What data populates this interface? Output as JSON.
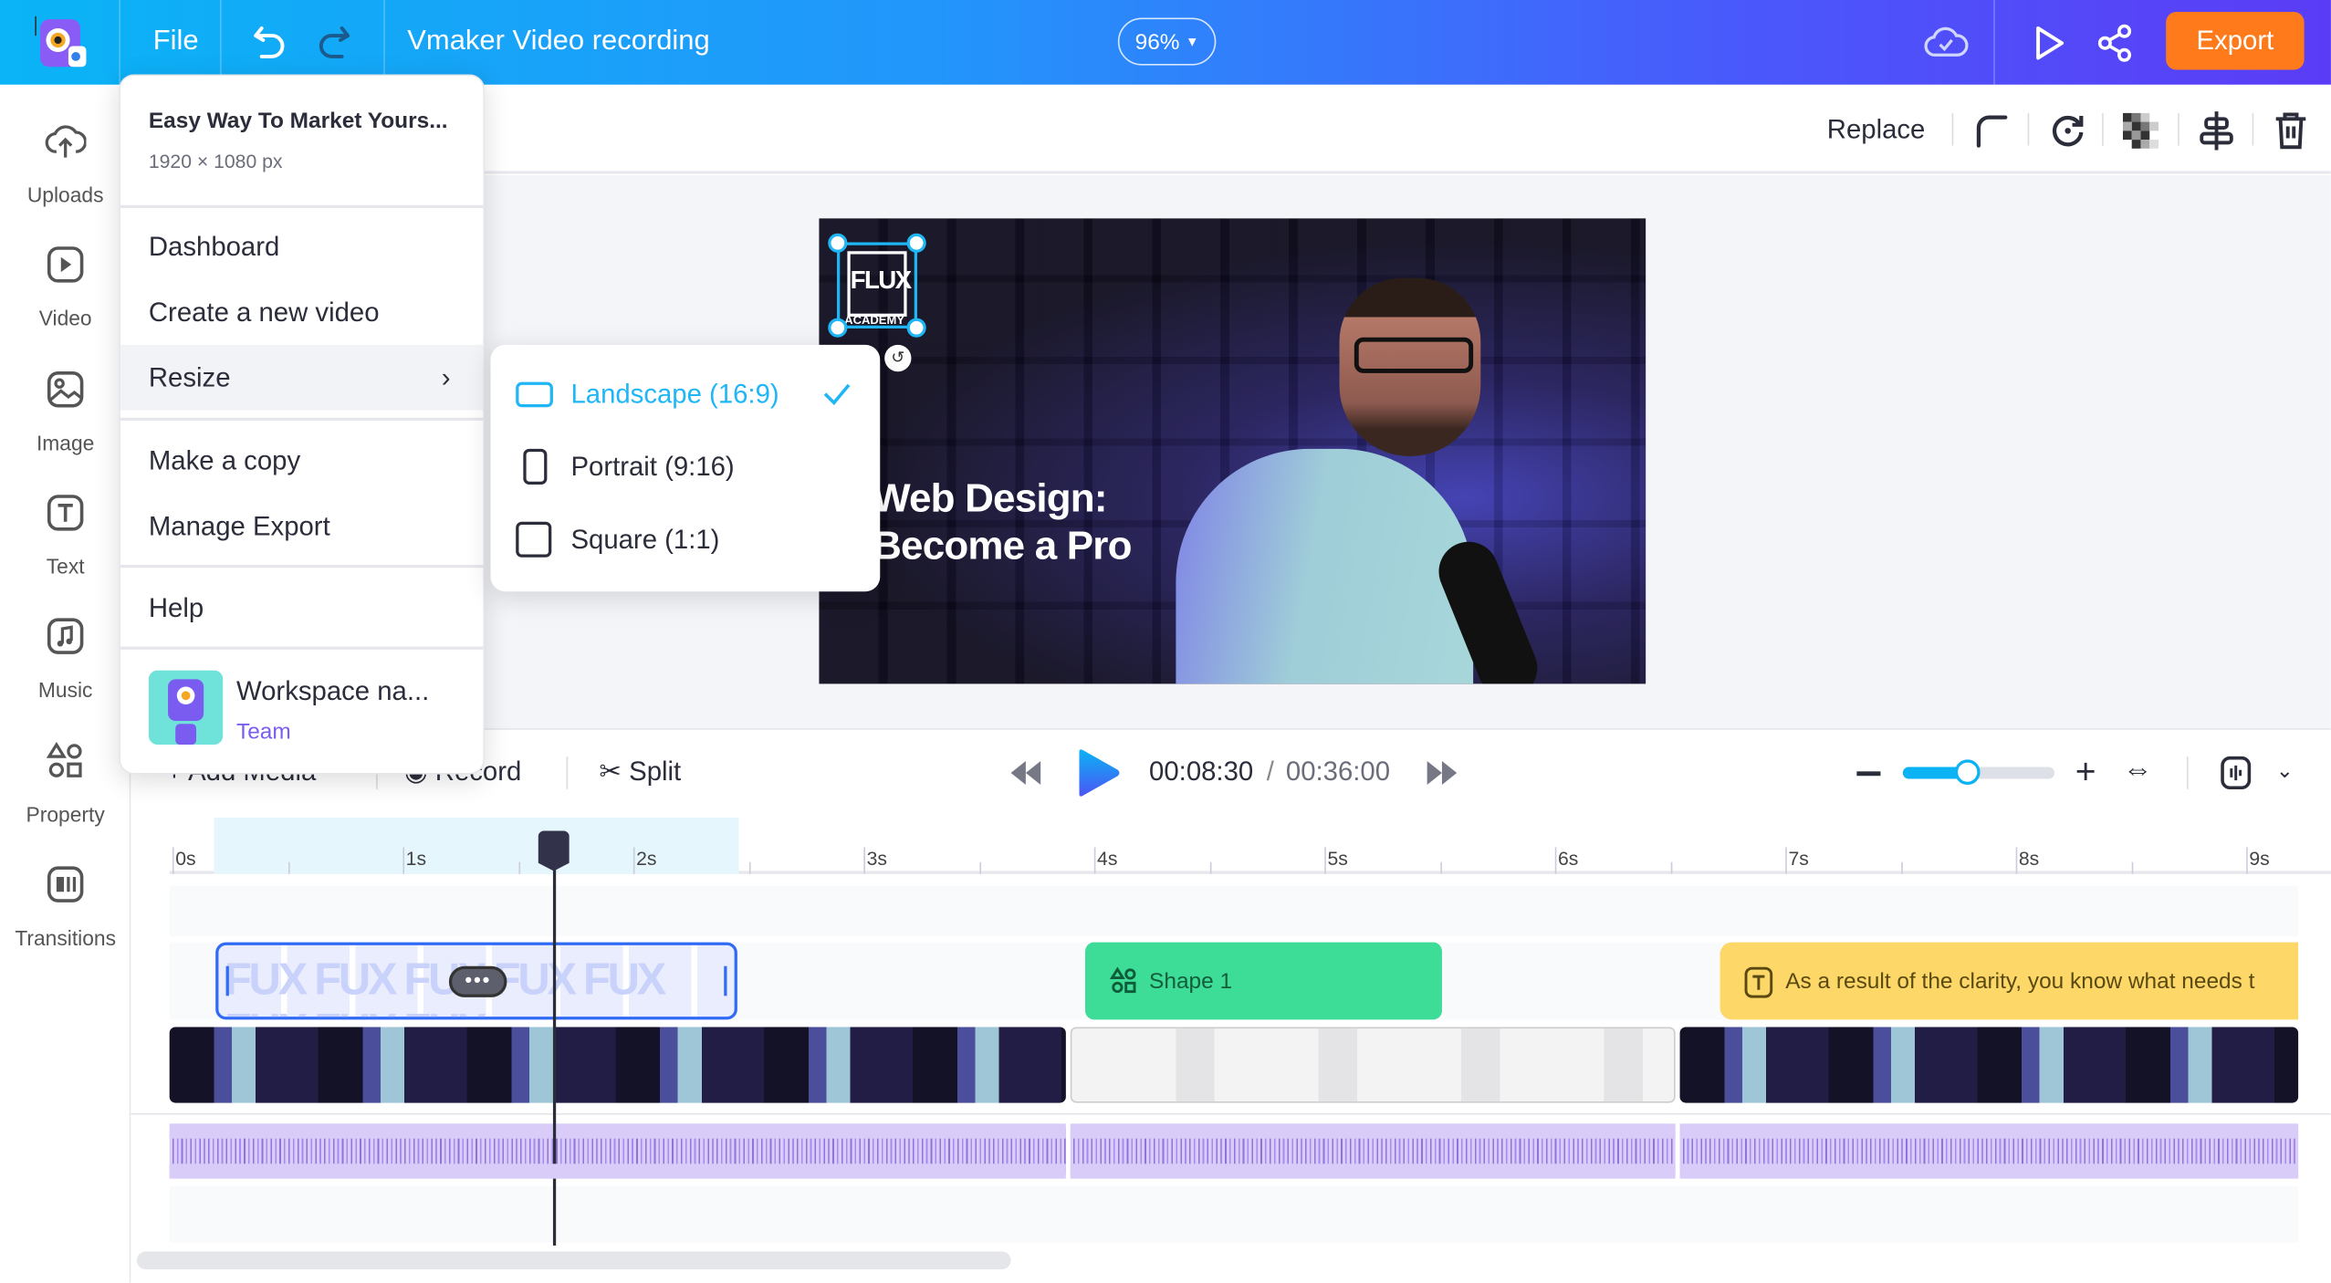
{
  "header": {
    "file_label": "File",
    "project_title": "Vmaker Video recording",
    "zoom_level": "96%",
    "export_label": "Export",
    "icons": [
      "app-logo",
      "undo-icon",
      "redo-icon",
      "cloud-saved-icon",
      "play-icon",
      "share-icon"
    ],
    "export_color": "#ff7a1a"
  },
  "sidebar": {
    "items": [
      {
        "label": "Uploads",
        "icon": "cloud-upload-icon"
      },
      {
        "label": "Video",
        "icon": "video-icon"
      },
      {
        "label": "Image",
        "icon": "image-icon"
      },
      {
        "label": "Text",
        "icon": "text-icon"
      },
      {
        "label": "Music",
        "icon": "music-icon"
      },
      {
        "label": "Property",
        "icon": "shapes-icon"
      },
      {
        "label": "Transitions",
        "icon": "transitions-icon"
      }
    ]
  },
  "toolbar": {
    "replace_label": "Replace",
    "icons": [
      "corner-radius-icon",
      "rotate-icon",
      "transparency-icon",
      "align-icon",
      "trash-icon"
    ]
  },
  "canvas": {
    "video_title_line1": "Web Design:",
    "video_title_line2": "Become a Pro",
    "logo_text": "FLUX",
    "logo_subtext": "ACADEMY"
  },
  "file_menu": {
    "project_name": "Easy Way To Market Yours...",
    "dimensions": "1920 × 1080 px",
    "items": [
      "Dashboard",
      "Create a new video",
      "Resize",
      "Make a copy",
      "Manage Export",
      "Help"
    ],
    "workspace_name": "Workspace na...",
    "workspace_type": "Team"
  },
  "resize_menu": {
    "options": [
      {
        "label": "Landscape (16:9)",
        "selected": true
      },
      {
        "label": "Portrait (9:16)",
        "selected": false
      },
      {
        "label": "Square (1:1)",
        "selected": false
      }
    ],
    "accent": "#1fb6f5"
  },
  "timeline": {
    "add_media_label": "Add Media",
    "record_label": "Record",
    "split_label": "Split",
    "current_time": "00:08:30",
    "separator": "/",
    "total_time": "00:36:00",
    "zoom_slider_value": 0.42,
    "ruler_labels": [
      "0s",
      "1s",
      "2s",
      "3s",
      "4s",
      "5s",
      "6s",
      "7s",
      "8s",
      "9s"
    ],
    "shape_clip_label": "Shape 1",
    "text_clip_label": "As a result of the clarity, you know what needs t",
    "colors": {
      "shape": "#3ddc97",
      "text": "#fdd868",
      "audio": "#d9ccf8",
      "selection": "#2f6bf5"
    }
  }
}
